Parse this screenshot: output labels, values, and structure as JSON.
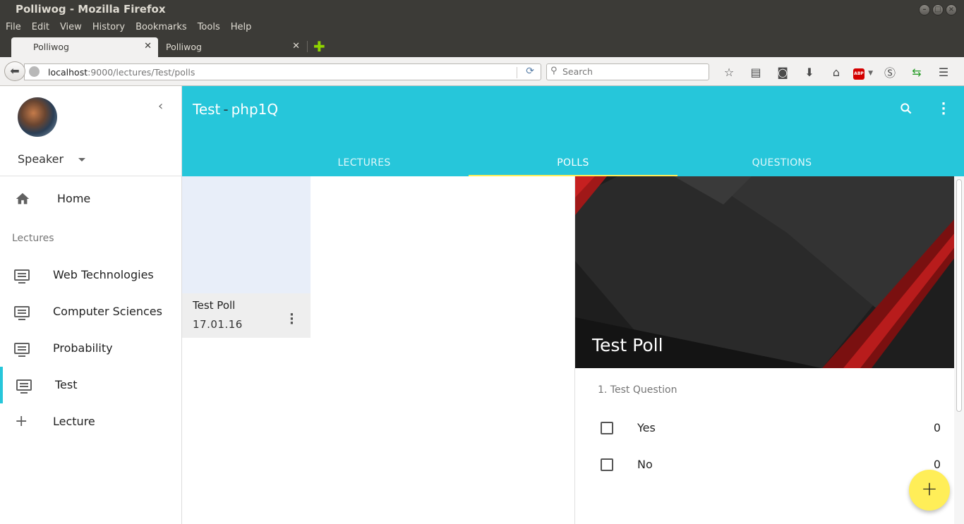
{
  "window": {
    "title": "Polliwog - Mozilla Firefox"
  },
  "menu": [
    "File",
    "Edit",
    "View",
    "History",
    "Bookmarks",
    "Tools",
    "Help"
  ],
  "browser_tabs": [
    {
      "label": "Polliwog",
      "active": true
    },
    {
      "label": "Polliwog",
      "active": false
    }
  ],
  "address": {
    "host": "localhost",
    "rest": ":9000/lectures/Test/polls"
  },
  "search": {
    "placeholder": "Search"
  },
  "drawer": {
    "role": "Speaker",
    "home": "Home",
    "section": "Lectures",
    "lectures": [
      "Web Technologies",
      "Computer Sciences",
      "Probability",
      "Test"
    ],
    "active_lecture": "Test",
    "add_label": "Lecture"
  },
  "header": {
    "lecture": "Test",
    "separator": "-",
    "code": "php1Q",
    "tabs": [
      "LECTURES",
      "POLLS",
      "QUESTIONS"
    ],
    "selected_tab": "POLLS"
  },
  "poll_card": {
    "title": "Test Poll",
    "date": "17.01.16"
  },
  "detail": {
    "title": "Test Poll",
    "question": "1. Test Question",
    "options": [
      {
        "label": "Yes",
        "count": "0"
      },
      {
        "label": "No",
        "count": "0"
      }
    ]
  },
  "fab": {
    "label": "+"
  },
  "colors": {
    "primary": "#26c6da",
    "accent": "#ffee58",
    "card_media": "#e8eef9"
  }
}
